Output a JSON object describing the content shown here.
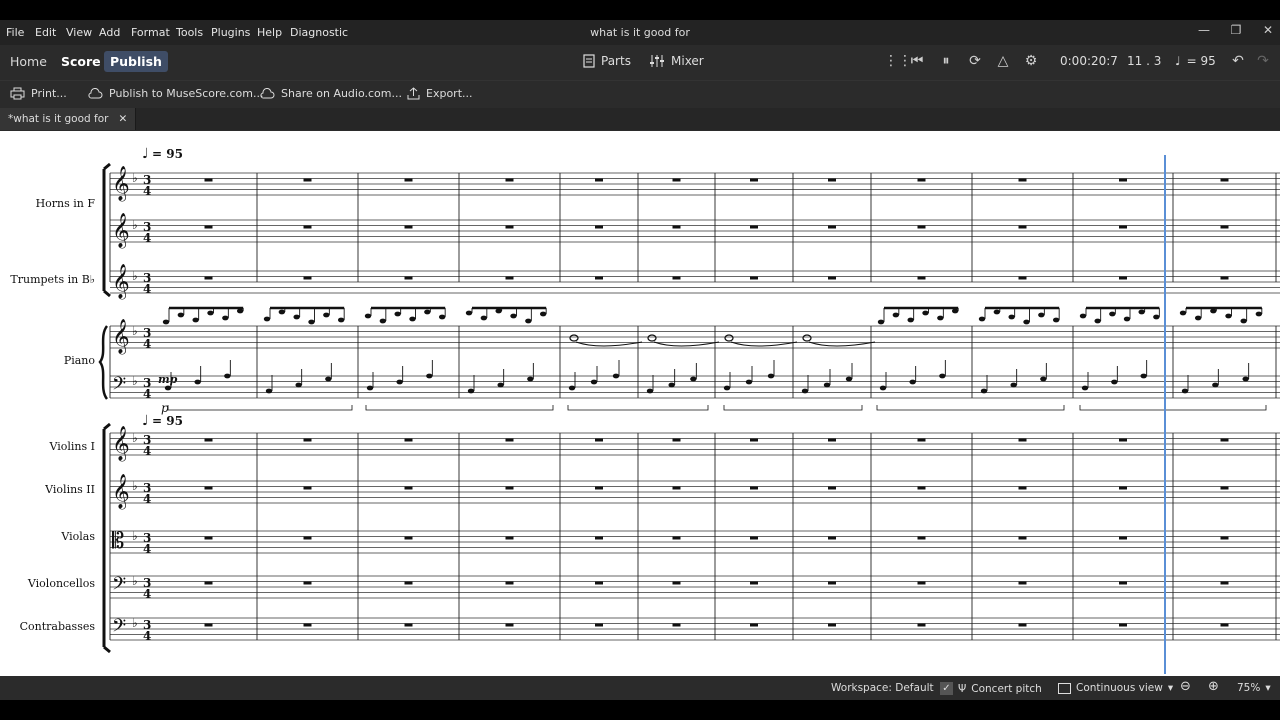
{
  "window": {
    "title": "what is it good for"
  },
  "menu": [
    "File",
    "Edit",
    "View",
    "Add",
    "Format",
    "Tools",
    "Plugins",
    "Help",
    "Diagnostic"
  ],
  "nav_tabs": {
    "home": "Home",
    "score": "Score",
    "publish": "Publish"
  },
  "toolbar": {
    "parts": "Parts",
    "mixer": "Mixer",
    "time": "0:00:20:7",
    "measure_beat": "11 . 3",
    "tempo": "= 95"
  },
  "publish_toolbar": {
    "print": "Print...",
    "publish_musescore": "Publish to MuseScore.com...",
    "share_audio": "Share on Audio.com...",
    "export": "Export..."
  },
  "document_tab": {
    "label": "*what is it good for"
  },
  "score": {
    "tempo_marking": "= 95",
    "dynamic": "mp",
    "pedal": "p",
    "instruments": [
      "Horns in F",
      "Trumpets in B♭",
      "Piano",
      "Violins I",
      "Violins II",
      "Violas",
      "Violoncellos",
      "Contrabasses"
    ]
  },
  "statusbar": {
    "workspace": "Workspace: Default",
    "concert_pitch": "Concert pitch",
    "view_mode": "Continuous view",
    "zoom": "75%"
  },
  "colors": {
    "accent": "#3f4d66",
    "playback_cursor": "#5a8fd6"
  }
}
